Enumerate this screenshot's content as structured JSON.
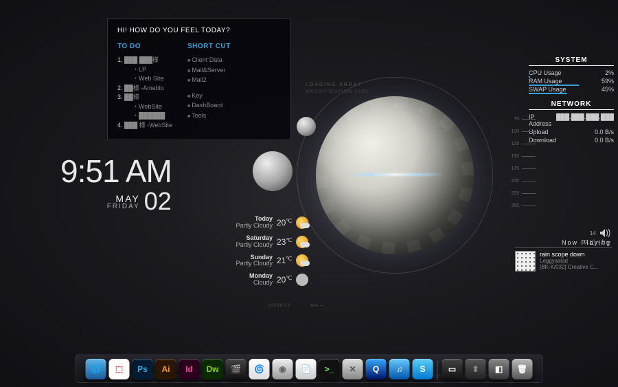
{
  "panel": {
    "title": "HI! HOW DO YOU FEEL TODAY?",
    "todo_header": "TO DO",
    "todo": [
      {
        "n": "1.",
        "main": "███ ███様",
        "subs": [
          "LP",
          "Web Site"
        ]
      },
      {
        "n": "2.",
        "main": "██様 -Ameblo",
        "subs": []
      },
      {
        "n": "3.",
        "main": "██様",
        "subs": [
          "WebSite",
          "██████"
        ]
      },
      {
        "n": "4.",
        "main": "███ 様 -WebSite",
        "subs": []
      }
    ],
    "shortcut_header": "SHORT CUT",
    "shortcuts_a": [
      "Client Data",
      "Mail&Server",
      "Mail2"
    ],
    "shortcuts_b": [
      "Key",
      "DashBoard",
      "Tools"
    ]
  },
  "clock": {
    "time": "9:51 AM",
    "month": "MAY",
    "dow": "FRIDAY",
    "day": "02"
  },
  "weather": [
    {
      "day": "Today",
      "cond": "Partly Cloudy",
      "temp": "20",
      "icon": "cloud"
    },
    {
      "day": "Saturday",
      "cond": "Partly Cloudy",
      "temp": "23",
      "icon": "cloud"
    },
    {
      "day": "Sunday",
      "cond": "Partly Cloudy",
      "temp": "21",
      "icon": "cloud"
    },
    {
      "day": "Monday",
      "cond": "Cloudy",
      "temp": "20",
      "icon": "cloudy"
    }
  ],
  "system": {
    "title": "SYSTEM",
    "rows": [
      {
        "label": "CPU Usage",
        "value": "2%",
        "pct": 2
      },
      {
        "label": "RAM Usage",
        "value": "59%",
        "pct": 59
      },
      {
        "label": "SWAP Usage",
        "value": "45%",
        "pct": 45
      }
    ],
    "net_title": "NETWORK",
    "net": [
      {
        "label": "IP Address",
        "value": "███.███.███.███"
      },
      {
        "label": "Upload",
        "value": "0.0 B/s"
      },
      {
        "label": "Download",
        "value": "0.0 B/s"
      }
    ]
  },
  "ruler": [
    "75",
    "100",
    "125",
    "150",
    "175",
    "200",
    "225",
    "250"
  ],
  "volume": {
    "level": "14",
    "label": "スピーカー"
  },
  "nowplaying": {
    "header": "Now Playing",
    "track": "rain scope down",
    "artist": "Leggysalad",
    "album": "[BK-K/032] Creative C..."
  },
  "dock": [
    {
      "name": "globe",
      "bg": "linear-gradient(#5bb5e8,#1a5a9a)",
      "txt": "🌐"
    },
    {
      "name": "grid",
      "bg": "#fff",
      "txt": "⬚",
      "color": "#e33"
    },
    {
      "name": "photoshop",
      "bg": "#001c33",
      "txt": "Ps",
      "color": "#29abe2"
    },
    {
      "name": "illustrator",
      "bg": "#2a1500",
      "txt": "Ai",
      "color": "#ff9a00"
    },
    {
      "name": "indesign",
      "bg": "#2a001c",
      "txt": "Id",
      "color": "#ff3f94"
    },
    {
      "name": "dreamweaver",
      "bg": "#0a2a00",
      "txt": "Dw",
      "color": "#8fce00"
    },
    {
      "name": "clapper",
      "bg": "linear-gradient(#444,#111)",
      "txt": "🎬"
    },
    {
      "name": "blender",
      "bg": "linear-gradient(#fff,#ddd)",
      "txt": "🌀",
      "color": "#f57900"
    },
    {
      "name": "disc",
      "bg": "linear-gradient(#eee,#999)",
      "txt": "◉",
      "color": "#666"
    },
    {
      "name": "notes",
      "bg": "linear-gradient(#fff,#ccc)",
      "txt": "📄"
    },
    {
      "name": "terminal",
      "bg": "#111",
      "txt": ">_",
      "color": "#6f6"
    },
    {
      "name": "tools",
      "bg": "linear-gradient(#ddd,#888)",
      "txt": "✕",
      "color": "#555"
    },
    {
      "name": "quicktime",
      "bg": "linear-gradient(#3af,#016)",
      "txt": "Q"
    },
    {
      "name": "itunes",
      "bg": "linear-gradient(#6cf,#05a)",
      "txt": "♫"
    },
    {
      "name": "skype",
      "bg": "linear-gradient(#5ad0f4,#0078d4)",
      "txt": "S"
    },
    {
      "name": "sep",
      "sep": true
    },
    {
      "name": "window",
      "bg": "linear-gradient(#444,#111)",
      "txt": "▭"
    },
    {
      "name": "drive",
      "bg": "linear-gradient(#555,#222)",
      "txt": "⬍",
      "color": "#888"
    },
    {
      "name": "cube",
      "bg": "linear-gradient(#888,#333)",
      "txt": "◧"
    },
    {
      "name": "trash",
      "bg": "linear-gradient(#bbb,#555)",
      "txt": "🗑"
    }
  ],
  "wallpaper": {
    "loading": "LOADING ARRAY",
    "mag": "MAGNIFICATION X100"
  }
}
